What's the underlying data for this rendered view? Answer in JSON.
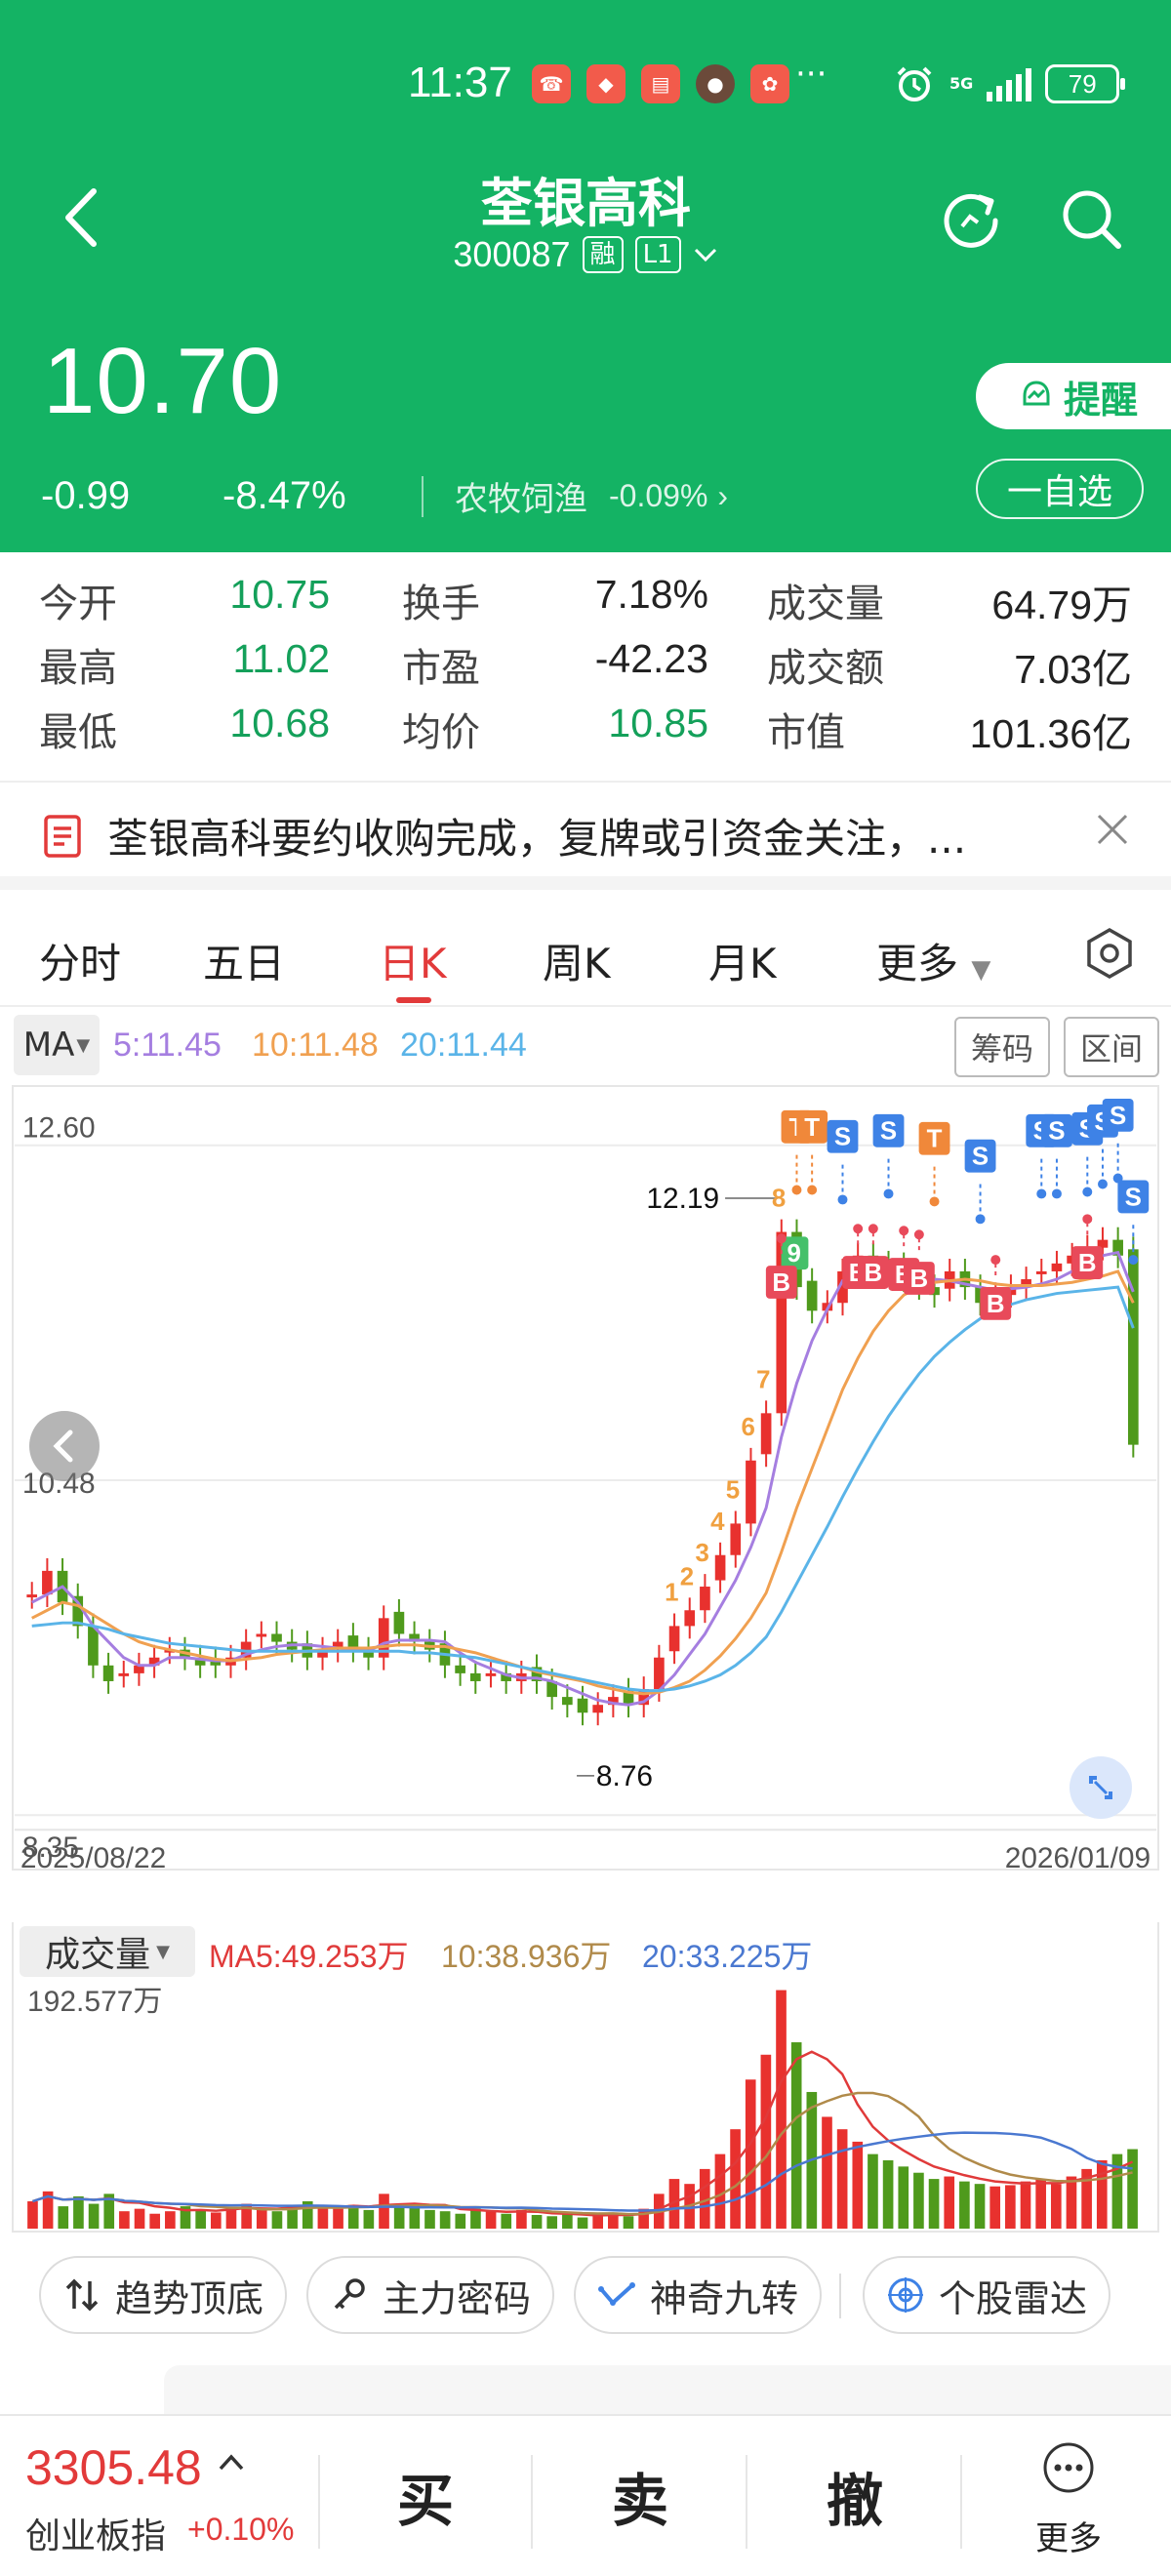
{
  "status_bar": {
    "time": "11:37",
    "network": "5G",
    "battery": "79"
  },
  "header": {
    "title": "荃银高科",
    "code": "300087",
    "tag_margin": "融",
    "tag_level": "L1"
  },
  "quote": {
    "price": "10.70",
    "change": "-0.99",
    "change_pct": "-8.47%",
    "sector": "农牧饲渔",
    "sector_change": "-0.09%",
    "alert_label": "提醒",
    "watchlist_label": "一自选"
  },
  "stats": [
    {
      "l1": "今开",
      "v1": "10.75",
      "l2": "换手",
      "v2": "7.18%",
      "l3": "成交量",
      "v3": "64.79万"
    },
    {
      "l1": "最高",
      "v1": "11.02",
      "l2": "市盈",
      "v2": "-42.23",
      "l3": "成交额",
      "v3": "7.03亿"
    },
    {
      "l1": "最低",
      "v1": "10.68",
      "l2": "均价",
      "v2": "10.85",
      "l3": "市值",
      "v3": "101.36亿"
    }
  ],
  "news": {
    "text": "荃银高科要约收购完成，复牌或引资金关注，..."
  },
  "tabs": [
    "分时",
    "五日",
    "日K",
    "周K",
    "月K",
    "更多"
  ],
  "active_tab": "日K",
  "ma": {
    "selector": "MA",
    "ma5": "5:11.45",
    "ma10": "10:11.48",
    "ma20": "20:11.44",
    "chip_label": "筹码",
    "range_label": "区间",
    "colors": {
      "ma5": "#a57ee0",
      "ma10": "#f0a050",
      "ma20": "#5ab4e8",
      "up": "#e8312e",
      "down": "#4f9a1c",
      "buy": "#e84a5a",
      "sell": "#3e82e6",
      "t": "#f0883a"
    }
  },
  "chart_data": {
    "type": "candlestick",
    "y_top_label": "12.60",
    "y_mid_label": "10.48",
    "y_bottom_label": "8.35",
    "ylim": [
      8.35,
      12.6
    ],
    "start_date": "2025/08/22",
    "end_date": "2026/01/09",
    "high_marker": "12.19",
    "low_marker": "8.76",
    "sequence_labels": [
      "1",
      "2",
      "3",
      "4",
      "5",
      "6",
      "7",
      "8",
      "9"
    ],
    "signal_markers": [
      "T",
      "T",
      "S",
      "S",
      "T",
      "S",
      "S",
      "S",
      "S",
      "S",
      "S",
      "S",
      "B",
      "B",
      "B",
      "B",
      "B",
      "B",
      "B"
    ],
    "closes": [
      9.75,
      9.9,
      9.7,
      9.55,
      9.3,
      9.2,
      9.25,
      9.3,
      9.35,
      9.4,
      9.35,
      9.3,
      9.3,
      9.35,
      9.45,
      9.5,
      9.45,
      9.4,
      9.35,
      9.4,
      9.45,
      9.4,
      9.35,
      9.6,
      9.5,
      9.45,
      9.4,
      9.3,
      9.25,
      9.2,
      9.25,
      9.2,
      9.25,
      9.2,
      9.1,
      9.05,
      9.0,
      9.05,
      9.1,
      9.05,
      9.15,
      9.35,
      9.55,
      9.65,
      9.8,
      10.0,
      10.2,
      10.6,
      10.9,
      12.05,
      11.7,
      11.55,
      11.6,
      11.8,
      11.9,
      11.85,
      11.8,
      11.75,
      11.7,
      11.65,
      11.8,
      11.7,
      11.6,
      11.65,
      11.7,
      11.75,
      11.8,
      11.85,
      11.9,
      11.95,
      12.0,
      11.9,
      10.7
    ],
    "ma5": [
      9.7,
      9.75,
      9.8,
      9.7,
      9.55,
      9.45,
      9.35,
      9.3,
      9.3,
      9.35,
      9.35,
      9.34,
      9.33,
      9.33,
      9.37,
      9.4,
      9.42,
      9.43,
      9.43,
      9.42,
      9.41,
      9.4,
      9.39,
      9.44,
      9.46,
      9.46,
      9.46,
      9.45,
      9.38,
      9.32,
      9.28,
      9.24,
      9.22,
      9.22,
      9.2,
      9.16,
      9.12,
      9.08,
      9.06,
      9.05,
      9.07,
      9.14,
      9.24,
      9.37,
      9.5,
      9.67,
      9.84,
      10.05,
      10.3,
      10.75,
      11.09,
      11.36,
      11.56,
      11.74,
      11.71,
      11.74,
      11.79,
      11.82,
      11.8,
      11.75,
      11.74,
      11.72,
      11.7,
      11.68,
      11.69,
      11.7,
      11.72,
      11.75,
      11.8,
      11.85,
      11.9,
      11.92,
      11.67
    ],
    "ma10": [
      9.6,
      9.65,
      9.7,
      9.68,
      9.62,
      9.56,
      9.5,
      9.45,
      9.42,
      9.4,
      9.38,
      9.36,
      9.34,
      9.33,
      9.34,
      9.35,
      9.37,
      9.38,
      9.39,
      9.4,
      9.41,
      9.41,
      9.41,
      9.42,
      9.43,
      9.43,
      9.42,
      9.42,
      9.4,
      9.38,
      9.35,
      9.32,
      9.29,
      9.26,
      9.24,
      9.22,
      9.2,
      9.17,
      9.15,
      9.13,
      9.12,
      9.13,
      9.16,
      9.2,
      9.27,
      9.36,
      9.47,
      9.6,
      9.76,
      10.02,
      10.3,
      10.55,
      10.8,
      11.05,
      11.25,
      11.42,
      11.55,
      11.65,
      11.7,
      11.73,
      11.74,
      11.75,
      11.74,
      11.72,
      11.71,
      11.71,
      11.71,
      11.72,
      11.73,
      11.75,
      11.77,
      11.8,
      11.6
    ],
    "ma20": [
      9.55,
      9.56,
      9.57,
      9.57,
      9.55,
      9.53,
      9.5,
      9.48,
      9.46,
      9.44,
      9.43,
      9.42,
      9.41,
      9.4,
      9.39,
      9.39,
      9.39,
      9.39,
      9.39,
      9.39,
      9.39,
      9.39,
      9.39,
      9.39,
      9.39,
      9.38,
      9.38,
      9.37,
      9.36,
      9.35,
      9.33,
      9.31,
      9.29,
      9.27,
      9.25,
      9.23,
      9.21,
      9.19,
      9.17,
      9.15,
      9.14,
      9.14,
      9.15,
      9.17,
      9.2,
      9.24,
      9.3,
      9.38,
      9.48,
      9.64,
      9.82,
      10.0,
      10.18,
      10.37,
      10.55,
      10.72,
      10.88,
      11.02,
      11.15,
      11.26,
      11.35,
      11.43,
      11.5,
      11.55,
      11.59,
      11.62,
      11.64,
      11.66,
      11.67,
      11.68,
      11.69,
      11.7,
      11.44
    ]
  },
  "volume": {
    "selector": "成交量",
    "ma5": "MA5:49.253万",
    "ma10": "10:38.936万",
    "ma20": "20:33.225万",
    "max_label": "192.577万",
    "colors": {
      "ma5": "#e03a3a",
      "ma10": "#b08a4a",
      "ma20": "#4a78d0"
    },
    "values": [
      22,
      30,
      18,
      26,
      20,
      28,
      14,
      16,
      12,
      14,
      18,
      15,
      13,
      17,
      20,
      16,
      14,
      18,
      22,
      17,
      16,
      19,
      15,
      28,
      20,
      18,
      15,
      14,
      12,
      16,
      14,
      12,
      15,
      11,
      10,
      12,
      9,
      11,
      13,
      10,
      16,
      28,
      40,
      36,
      48,
      60,
      80,
      120,
      140,
      192,
      150,
      110,
      90,
      80,
      70,
      60,
      55,
      50,
      45,
      40,
      42,
      38,
      36,
      34,
      35,
      38,
      40,
      36,
      42,
      48,
      55,
      60,
      64
    ]
  },
  "tools": [
    "趋势顶底",
    "主力密码",
    "神奇九转",
    "个股雷达"
  ],
  "bottom": {
    "index_value": "3305.48",
    "index_name": "创业板指",
    "index_change": "+0.10%",
    "buy": "买",
    "sell": "卖",
    "cancel": "撤",
    "more": "更多"
  }
}
